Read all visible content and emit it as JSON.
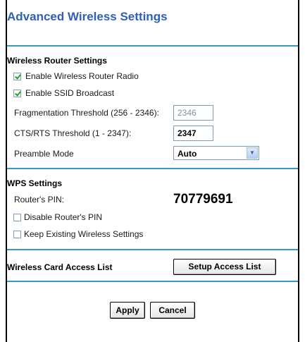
{
  "page": {
    "title": "Advanced Wireless Settings"
  },
  "wireless_router_settings": {
    "title": "Wireless Router Settings",
    "enable_radio": {
      "label": "Enable Wireless Router Radio",
      "checked": true
    },
    "enable_ssid": {
      "label": "Enable SSID Broadcast",
      "checked": true
    },
    "fragmentation": {
      "label": "Fragmentation Threshold (256 - 2346):",
      "value": "2346"
    },
    "cts_rts": {
      "label": "CTS/RTS Threshold (1 - 2347):",
      "value": "2347"
    },
    "preamble": {
      "label": "Preamble Mode",
      "value": "Auto"
    }
  },
  "wps_settings": {
    "title": "WPS Settings",
    "pin_label": "Router's PIN:",
    "pin_value": "70779691",
    "disable_pin": {
      "label": "Disable Router's PIN",
      "checked": false
    },
    "keep_existing": {
      "label": "Keep Existing Wireless Settings",
      "checked": false
    }
  },
  "access_list": {
    "title": "Wireless Card Access List",
    "button_label": "Setup Access List"
  },
  "actions": {
    "apply_label": "Apply",
    "cancel_label": "Cancel"
  },
  "colors": {
    "title": "#2f5fb6",
    "separator": "#2f9ad0",
    "check": "#21a121"
  }
}
